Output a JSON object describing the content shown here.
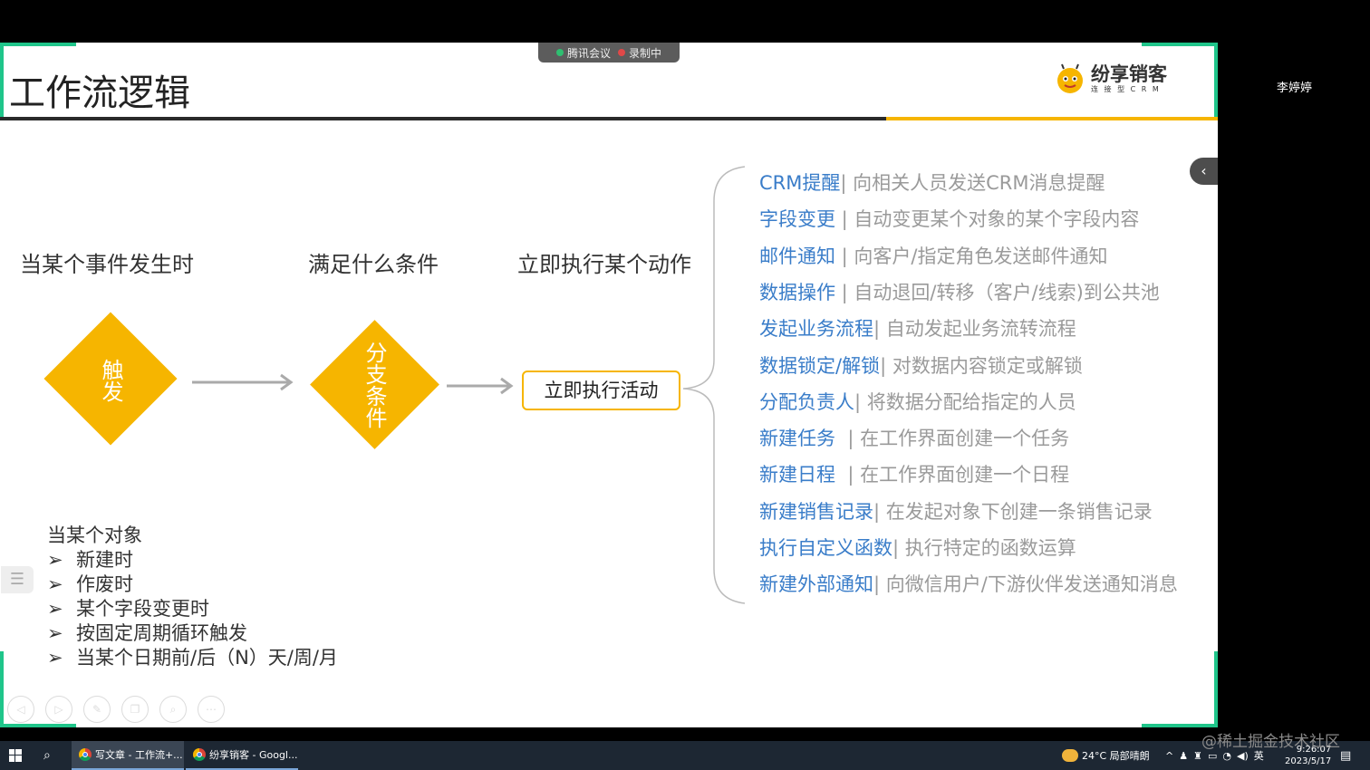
{
  "meeting": {
    "app": "腾讯会议",
    "status": "录制中"
  },
  "participant": {
    "name": "李婷婷"
  },
  "slide": {
    "title": "工作流逻辑",
    "logo": {
      "name": "纷享销客",
      "tagline": "连 接 型 C R M"
    },
    "steps": [
      {
        "heading": "当某个事件发生时",
        "shape_text": "触发"
      },
      {
        "heading": "满足什么条件",
        "shape_text": "分支条件"
      },
      {
        "heading": "立即执行某个动作",
        "box_text": "立即执行活动"
      }
    ],
    "actions": [
      {
        "name": "CRM提醒",
        "desc": "| 向相关人员发送CRM消息提醒"
      },
      {
        "name": "字段变更",
        "desc": " | 自动变更某个对象的某个字段内容"
      },
      {
        "name": "邮件通知",
        "desc": " | 向客户/指定角色发送邮件通知"
      },
      {
        "name": "数据操作",
        "desc": " | 自动退回/转移（客户/线索)到公共池"
      },
      {
        "name": "发起业务流程",
        "desc": "| 自动发起业务流转流程"
      },
      {
        "name": "数据锁定/解锁",
        "desc": "| 对数据内容锁定或解锁"
      },
      {
        "name": "分配负责人",
        "desc": "| 将数据分配给指定的人员"
      },
      {
        "name": "新建任务",
        "desc": "  | 在工作界面创建一个任务"
      },
      {
        "name": "新建日程",
        "desc": "  | 在工作界面创建一个日程"
      },
      {
        "name": "新建销售记录",
        "desc": "| 在发起对象下创建一条销售记录"
      },
      {
        "name": "执行自定义函数",
        "desc": "| 执行特定的函数运算"
      },
      {
        "name": "新建外部通知",
        "desc": "| 向微信用户/下游伙伴发送通知消息"
      }
    ],
    "triggers": {
      "heading": "当某个对象",
      "bullet": "➢",
      "items": [
        "新建时",
        "作废时",
        "某个字段变更时",
        "按固定周期循环触发",
        "当某个日期前/后（N）天/周/月"
      ]
    }
  },
  "watermark": "@稀土掘金技术社区",
  "taskbar": {
    "items": [
      {
        "label": "写文章 - 工作流+..."
      },
      {
        "label": "纷享销客 - Googl..."
      }
    ],
    "weather": "24°C  局部晴朗",
    "ime": "英",
    "time": "9:26:07",
    "date": "2023/5/17"
  },
  "colors": {
    "accent": "#f6b500",
    "frame": "#1fc58a",
    "action_name": "#3a7dc9"
  }
}
